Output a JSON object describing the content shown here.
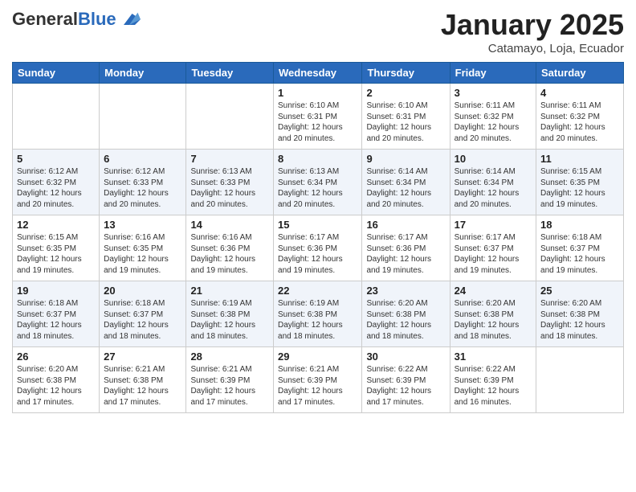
{
  "header": {
    "logo_general": "General",
    "logo_blue": "Blue",
    "month_title": "January 2025",
    "subtitle": "Catamayo, Loja, Ecuador"
  },
  "weekdays": [
    "Sunday",
    "Monday",
    "Tuesday",
    "Wednesday",
    "Thursday",
    "Friday",
    "Saturday"
  ],
  "weeks": [
    [
      {
        "day": "",
        "info": ""
      },
      {
        "day": "",
        "info": ""
      },
      {
        "day": "",
        "info": ""
      },
      {
        "day": "1",
        "info": "Sunrise: 6:10 AM\nSunset: 6:31 PM\nDaylight: 12 hours and 20 minutes."
      },
      {
        "day": "2",
        "info": "Sunrise: 6:10 AM\nSunset: 6:31 PM\nDaylight: 12 hours and 20 minutes."
      },
      {
        "day": "3",
        "info": "Sunrise: 6:11 AM\nSunset: 6:32 PM\nDaylight: 12 hours and 20 minutes."
      },
      {
        "day": "4",
        "info": "Sunrise: 6:11 AM\nSunset: 6:32 PM\nDaylight: 12 hours and 20 minutes."
      }
    ],
    [
      {
        "day": "5",
        "info": "Sunrise: 6:12 AM\nSunset: 6:32 PM\nDaylight: 12 hours and 20 minutes."
      },
      {
        "day": "6",
        "info": "Sunrise: 6:12 AM\nSunset: 6:33 PM\nDaylight: 12 hours and 20 minutes."
      },
      {
        "day": "7",
        "info": "Sunrise: 6:13 AM\nSunset: 6:33 PM\nDaylight: 12 hours and 20 minutes."
      },
      {
        "day": "8",
        "info": "Sunrise: 6:13 AM\nSunset: 6:34 PM\nDaylight: 12 hours and 20 minutes."
      },
      {
        "day": "9",
        "info": "Sunrise: 6:14 AM\nSunset: 6:34 PM\nDaylight: 12 hours and 20 minutes."
      },
      {
        "day": "10",
        "info": "Sunrise: 6:14 AM\nSunset: 6:34 PM\nDaylight: 12 hours and 20 minutes."
      },
      {
        "day": "11",
        "info": "Sunrise: 6:15 AM\nSunset: 6:35 PM\nDaylight: 12 hours and 19 minutes."
      }
    ],
    [
      {
        "day": "12",
        "info": "Sunrise: 6:15 AM\nSunset: 6:35 PM\nDaylight: 12 hours and 19 minutes."
      },
      {
        "day": "13",
        "info": "Sunrise: 6:16 AM\nSunset: 6:35 PM\nDaylight: 12 hours and 19 minutes."
      },
      {
        "day": "14",
        "info": "Sunrise: 6:16 AM\nSunset: 6:36 PM\nDaylight: 12 hours and 19 minutes."
      },
      {
        "day": "15",
        "info": "Sunrise: 6:17 AM\nSunset: 6:36 PM\nDaylight: 12 hours and 19 minutes."
      },
      {
        "day": "16",
        "info": "Sunrise: 6:17 AM\nSunset: 6:36 PM\nDaylight: 12 hours and 19 minutes."
      },
      {
        "day": "17",
        "info": "Sunrise: 6:17 AM\nSunset: 6:37 PM\nDaylight: 12 hours and 19 minutes."
      },
      {
        "day": "18",
        "info": "Sunrise: 6:18 AM\nSunset: 6:37 PM\nDaylight: 12 hours and 19 minutes."
      }
    ],
    [
      {
        "day": "19",
        "info": "Sunrise: 6:18 AM\nSunset: 6:37 PM\nDaylight: 12 hours and 18 minutes."
      },
      {
        "day": "20",
        "info": "Sunrise: 6:18 AM\nSunset: 6:37 PM\nDaylight: 12 hours and 18 minutes."
      },
      {
        "day": "21",
        "info": "Sunrise: 6:19 AM\nSunset: 6:38 PM\nDaylight: 12 hours and 18 minutes."
      },
      {
        "day": "22",
        "info": "Sunrise: 6:19 AM\nSunset: 6:38 PM\nDaylight: 12 hours and 18 minutes."
      },
      {
        "day": "23",
        "info": "Sunrise: 6:20 AM\nSunset: 6:38 PM\nDaylight: 12 hours and 18 minutes."
      },
      {
        "day": "24",
        "info": "Sunrise: 6:20 AM\nSunset: 6:38 PM\nDaylight: 12 hours and 18 minutes."
      },
      {
        "day": "25",
        "info": "Sunrise: 6:20 AM\nSunset: 6:38 PM\nDaylight: 12 hours and 18 minutes."
      }
    ],
    [
      {
        "day": "26",
        "info": "Sunrise: 6:20 AM\nSunset: 6:38 PM\nDaylight: 12 hours and 17 minutes."
      },
      {
        "day": "27",
        "info": "Sunrise: 6:21 AM\nSunset: 6:38 PM\nDaylight: 12 hours and 17 minutes."
      },
      {
        "day": "28",
        "info": "Sunrise: 6:21 AM\nSunset: 6:39 PM\nDaylight: 12 hours and 17 minutes."
      },
      {
        "day": "29",
        "info": "Sunrise: 6:21 AM\nSunset: 6:39 PM\nDaylight: 12 hours and 17 minutes."
      },
      {
        "day": "30",
        "info": "Sunrise: 6:22 AM\nSunset: 6:39 PM\nDaylight: 12 hours and 17 minutes."
      },
      {
        "day": "31",
        "info": "Sunrise: 6:22 AM\nSunset: 6:39 PM\nDaylight: 12 hours and 16 minutes."
      },
      {
        "day": "",
        "info": ""
      }
    ]
  ]
}
